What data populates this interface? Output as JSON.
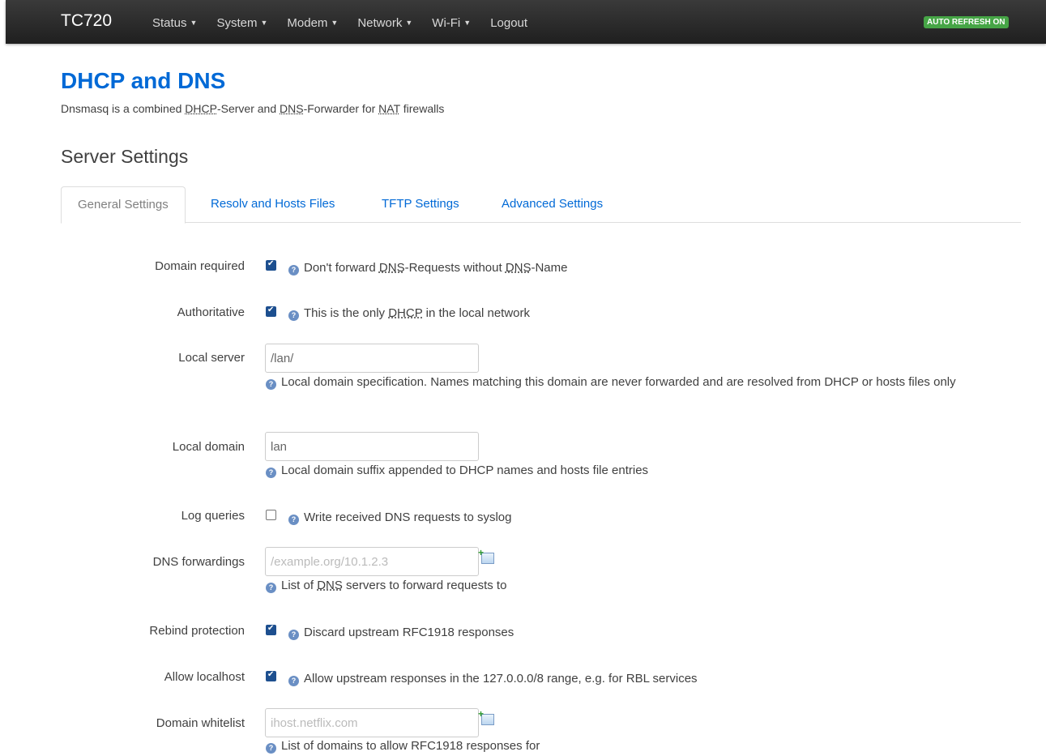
{
  "app": {
    "brand": "TC720",
    "auto_refresh": "AUTO REFRESH ON"
  },
  "menu": [
    {
      "label": "Status",
      "has_dropdown": true
    },
    {
      "label": "System",
      "has_dropdown": true
    },
    {
      "label": "Modem",
      "has_dropdown": true
    },
    {
      "label": "Network",
      "has_dropdown": true
    },
    {
      "label": "Wi-Fi",
      "has_dropdown": true
    },
    {
      "label": "Logout",
      "has_dropdown": false
    }
  ],
  "page": {
    "title": "DHCP and DNS",
    "description": {
      "p1": "Dnsmasq is a combined ",
      "abbr1": "DHCP",
      "p2": "-Server and ",
      "abbr2": "DNS",
      "p3": "-Forwarder for ",
      "abbr3": "NAT",
      "p4": " firewalls"
    },
    "section_title": "Server Settings"
  },
  "tabs": [
    {
      "label": "General Settings",
      "active": true
    },
    {
      "label": "Resolv and Hosts Files",
      "active": false
    },
    {
      "label": "TFTP Settings",
      "active": false
    },
    {
      "label": "Advanced Settings",
      "active": false
    }
  ],
  "fields": {
    "domain_required": {
      "label": "Domain required",
      "checked": true,
      "help1": "Don't forward ",
      "abbr1": "DNS",
      "help2": "-Requests without ",
      "abbr2": "DNS",
      "help3": "-Name"
    },
    "authoritative": {
      "label": "Authoritative",
      "checked": true,
      "help1": "This is the only ",
      "abbr1": "DHCP",
      "help2": " in the local network"
    },
    "local_server": {
      "label": "Local server",
      "value": "/lan/",
      "help": "Local domain specification. Names matching this domain are never forwarded and are resolved from DHCP or hosts files only"
    },
    "local_domain": {
      "label": "Local domain",
      "value": "lan",
      "help": "Local domain suffix appended to DHCP names and hosts file entries"
    },
    "log_queries": {
      "label": "Log queries",
      "checked": false,
      "help": "Write received DNS requests to syslog"
    },
    "dns_forwardings": {
      "label": "DNS forwardings",
      "value": "",
      "placeholder": "/example.org/10.1.2.3",
      "help1": "List of ",
      "abbr1": "DNS",
      "help2": " servers to forward requests to"
    },
    "rebind_protection": {
      "label": "Rebind protection",
      "checked": true,
      "help": "Discard upstream RFC1918 responses"
    },
    "allow_localhost": {
      "label": "Allow localhost",
      "checked": true,
      "help": "Allow upstream responses in the 127.0.0.0/8 range, e.g. for RBL services"
    },
    "domain_whitelist": {
      "label": "Domain whitelist",
      "value": "",
      "placeholder": "ihost.netflix.com",
      "help": "List of domains to allow RFC1918 responses for"
    }
  }
}
